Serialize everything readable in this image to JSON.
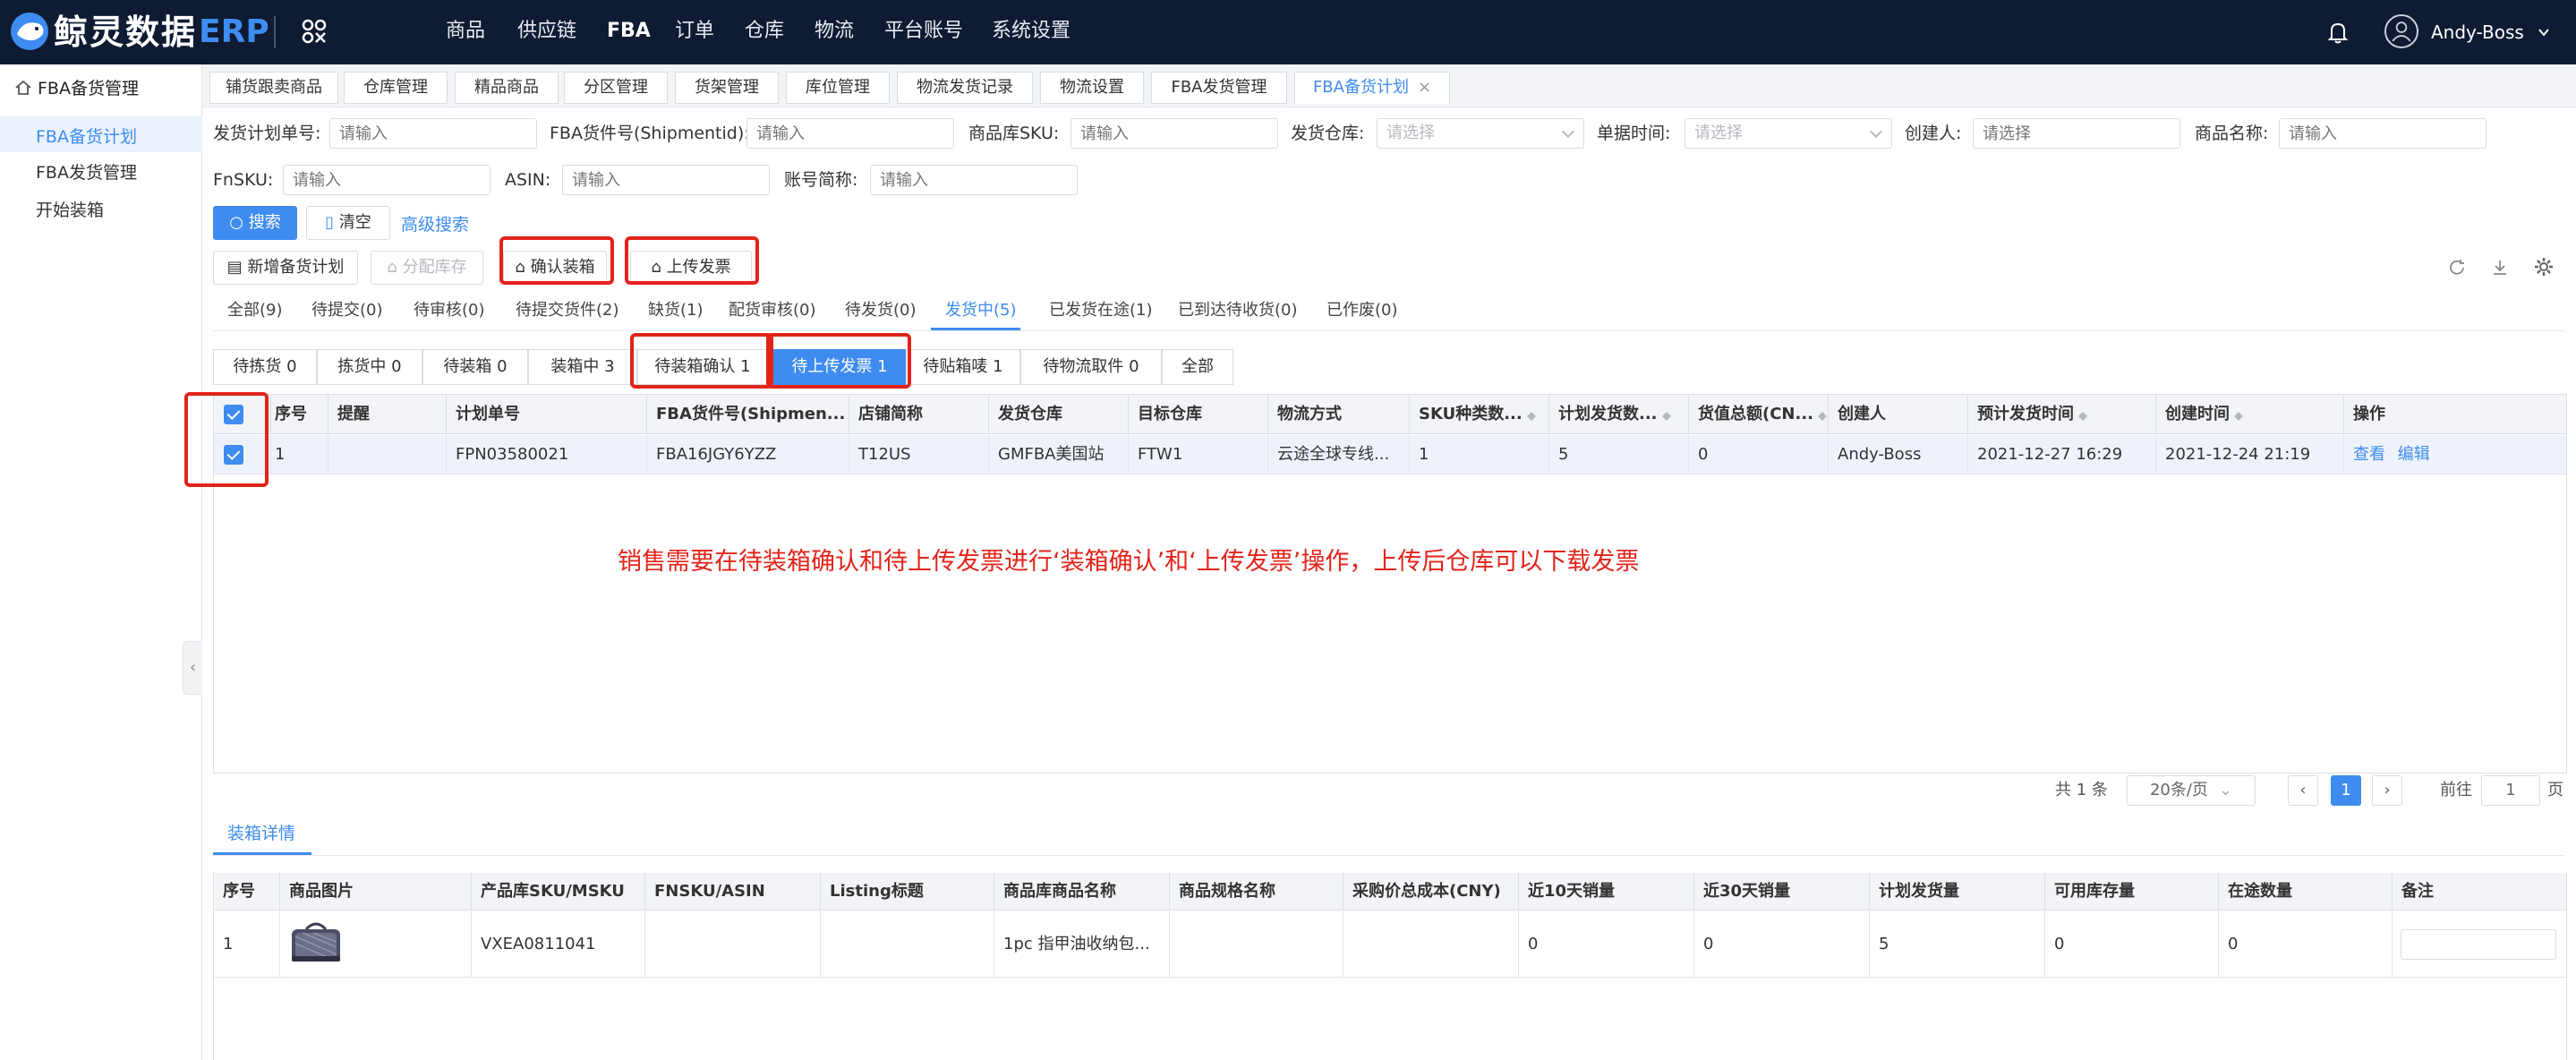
{
  "header": {
    "logo_text": "鲸灵数据",
    "logo_erp": "ERP",
    "nav": [
      "商品",
      "供应链",
      "FBA",
      "订单",
      "仓库",
      "物流",
      "平台账号",
      "系统设置"
    ],
    "user": "Andy-Boss"
  },
  "sidebar": {
    "title": "FBA备货管理",
    "items": [
      "FBA备货计划",
      "FBA发货管理",
      "开始装箱"
    ]
  },
  "tabs": [
    "铺货跟卖商品",
    "仓库管理",
    "精品商品",
    "分区管理",
    "货架管理",
    "库位管理",
    "物流发货记录",
    "物流设置",
    "FBA发货管理",
    "FBA备货计划"
  ],
  "filters": {
    "plan_no": {
      "label": "发货计划单号:",
      "placeholder": "请输入"
    },
    "shipment_id": {
      "label": "FBA货件号(Shipmentid):",
      "placeholder": "请输入"
    },
    "sku": {
      "label": "商品库SKU:",
      "placeholder": "请输入"
    },
    "warehouse": {
      "label": "发货仓库:",
      "placeholder": "请选择"
    },
    "date": {
      "label": "单据时间:",
      "placeholder": "请选择"
    },
    "creator": {
      "label": "创建人:",
      "placeholder": "请选择"
    },
    "product_name": {
      "label": "商品名称:",
      "placeholder": "请输入"
    },
    "fnsku": {
      "label": "FnSKU:",
      "placeholder": "请输入"
    },
    "asin": {
      "label": "ASIN:",
      "placeholder": "请输入"
    },
    "account": {
      "label": "账号简称:",
      "placeholder": "请输入"
    }
  },
  "actions": {
    "search": "搜索",
    "clear": "清空",
    "advanced": "高级搜索",
    "new_plan": "新增备货计划",
    "allocate": "分配库存",
    "confirm_box": "确认装箱",
    "upload_invoice": "上传发票"
  },
  "status_tabs": [
    "全部(9)",
    "待提交(0)",
    "待审核(0)",
    "待提交货件(2)",
    "缺货(1)",
    "配货审核(0)",
    "待发货(0)",
    "发货中(5)",
    "已发货在途(1)",
    "已到达待收货(0)",
    "已作废(0)"
  ],
  "sub_tabs": [
    "待拣货 0",
    "拣货中 0",
    "待装箱 0",
    "装箱中 3",
    "待装箱确认 1",
    "待上传发票 1",
    "待贴箱唛 1",
    "待物流取件 0",
    "全部"
  ],
  "table": {
    "headers": [
      "序号",
      "提醒",
      "计划单号",
      "FBA货件号(Shipmen...",
      "店铺简称",
      "发货仓库",
      "目标仓库",
      "物流方式",
      "SKU种类数...",
      "计划发货数...",
      "货值总额(CN...",
      "创建人",
      "预计发货时间",
      "创建时间",
      "操作"
    ],
    "rows": [
      {
        "no": "1",
        "remind": "",
        "plan_no": "FPN03580021",
        "shipment": "FBA16JGY6YZZ",
        "shop": "T12US",
        "warehouse": "GMFBA美国站",
        "target": "FTW1",
        "logistics": "云途全球专线...",
        "sku_types": "1",
        "plan_qty": "5",
        "value": "0",
        "creator": "Andy-Boss",
        "eta": "2021-12-27 16:29",
        "created": "2021-12-24 21:19",
        "op_view": "查看",
        "op_edit": "编辑"
      }
    ]
  },
  "annotation": "销售需要在待装箱确认和待上传发票进行‘装箱确认’和‘上传发票’操作，上传后仓库可以下载发票",
  "pagination": {
    "total": "共 1 条",
    "page_size": "20条/页",
    "current": "1",
    "goto_label": "前往",
    "goto_value": "1",
    "page_unit": "页"
  },
  "detail": {
    "tab": "装箱详情",
    "headers": [
      "序号",
      "商品图片",
      "产品库SKU/MSKU",
      "FNSKU/ASIN",
      "Listing标题",
      "商品库商品名称",
      "商品规格名称",
      "采购价总成本(CNY)",
      "近10天销量",
      "近30天销量",
      "计划发货量",
      "可用库存量",
      "在途数量",
      "备注"
    ],
    "rows": [
      {
        "no": "1",
        "sku": "VXEA0811041",
        "fnsku": "",
        "listing": "",
        "name": "1pc 指甲油收纳包...",
        "spec": "",
        "cost": "",
        "sales10": "0",
        "sales30": "0",
        "plan": "5",
        "stock": "0",
        "transit": "0"
      }
    ]
  },
  "colors": {
    "accent": "#3f8cf0",
    "topbar": "#0e1b33",
    "highlight": "#e2231a"
  }
}
